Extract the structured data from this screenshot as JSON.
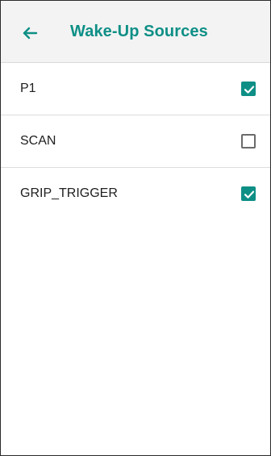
{
  "header": {
    "title": "Wake-Up Sources",
    "back_icon": "arrow-left-icon"
  },
  "colors": {
    "accent": "#0e8f86",
    "appbar_bg": "#f3f3f3",
    "text": "#202020",
    "divider": "#dcdcdc"
  },
  "sources": [
    {
      "label": "P1",
      "checked": true
    },
    {
      "label": "SCAN",
      "checked": false
    },
    {
      "label": "GRIP_TRIGGER",
      "checked": true
    }
  ]
}
